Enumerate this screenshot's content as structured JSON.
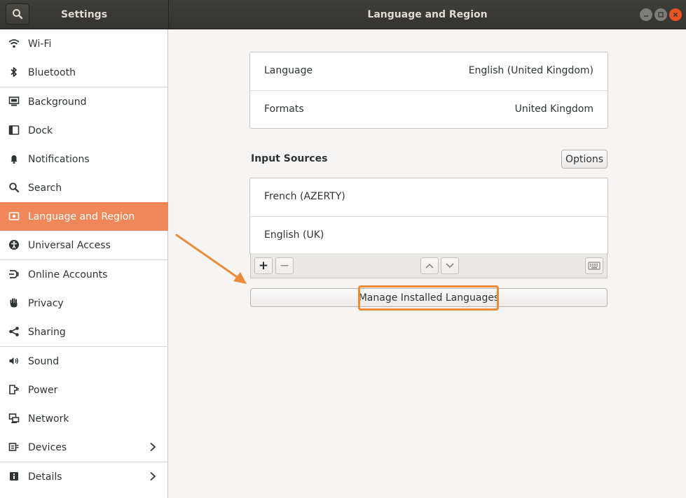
{
  "header": {
    "left_title": "Settings",
    "title": "Language and Region"
  },
  "sidebar": {
    "items": [
      {
        "label": "Wi-Fi",
        "icon": "wifi-icon"
      },
      {
        "label": "Bluetooth",
        "icon": "bluetooth-icon"
      },
      {
        "label": "Background",
        "icon": "background-icon"
      },
      {
        "label": "Dock",
        "icon": "dock-icon"
      },
      {
        "label": "Notifications",
        "icon": "bell-icon"
      },
      {
        "label": "Search",
        "icon": "search-icon"
      },
      {
        "label": "Language and Region",
        "icon": "flag-icon",
        "active": true
      },
      {
        "label": "Universal Access",
        "icon": "accessibility-icon"
      },
      {
        "label": "Online Accounts",
        "icon": "online-accounts-icon"
      },
      {
        "label": "Privacy",
        "icon": "hand-icon"
      },
      {
        "label": "Sharing",
        "icon": "share-icon"
      },
      {
        "label": "Sound",
        "icon": "speaker-icon"
      },
      {
        "label": "Power",
        "icon": "power-icon"
      },
      {
        "label": "Network",
        "icon": "network-icon"
      },
      {
        "label": "Devices",
        "icon": "devices-icon",
        "chevron": true
      },
      {
        "label": "Details",
        "icon": "info-icon",
        "chevron": true
      }
    ]
  },
  "main": {
    "language_label": "Language",
    "language_value": "English (United Kingdom)",
    "formats_label": "Formats",
    "formats_value": "United Kingdom",
    "input_sources_title": "Input Sources",
    "options_label": "Options",
    "input_sources": [
      "French (AZERTY)",
      "English (UK)"
    ],
    "add_label": "+",
    "remove_label": "−",
    "manage_label": "Manage Installed Languages"
  },
  "colors": {
    "accent": "#f0875a",
    "highlight": "#ec8b3a",
    "close": "#e95420"
  }
}
